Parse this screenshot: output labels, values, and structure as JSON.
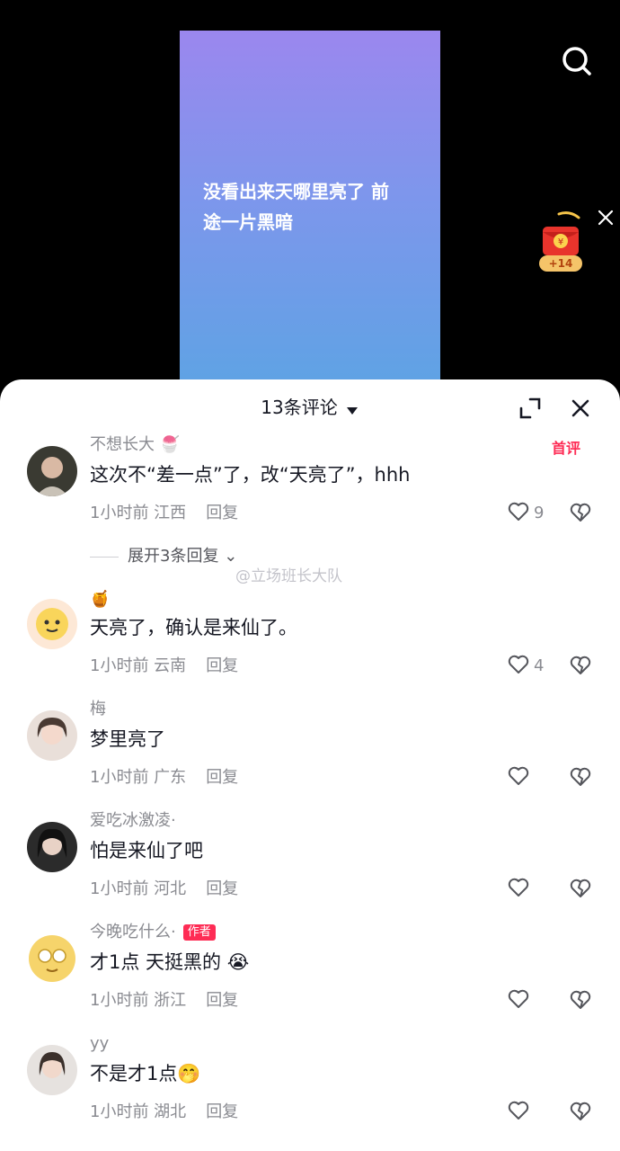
{
  "video": {
    "caption": "没看出来天哪里亮了 前途一片黑暗",
    "redpacket_count": "+14"
  },
  "comments_panel": {
    "title": "13条评论",
    "expand_replies": "展开3条回复",
    "watermark": "@立场班长大队",
    "first_badge": "首评",
    "author_tag": "作者",
    "reply_label": "回复",
    "comments": [
      {
        "user": "不想长大",
        "text": "这次不“差一点”了，改“天亮了”，hhh",
        "time": "1小时前 江西",
        "likes": "9"
      },
      {
        "user": "",
        "text": "天亮了，确认是来仙了。",
        "time": "1小时前 云南",
        "likes": "4"
      },
      {
        "user": "梅",
        "text": "梦里亮了",
        "time": "1小时前 广东",
        "likes": ""
      },
      {
        "user": "爱吃冰激凌·",
        "text": "怕是来仙了吧",
        "time": "1小时前 河北",
        "likes": ""
      },
      {
        "user": "今晚吃什么·",
        "text": "才1点 天挺黑的",
        "time": "1小时前 浙江",
        "likes": ""
      },
      {
        "user": "yy",
        "text": "不是才1点",
        "time": "1小时前 湖北",
        "likes": ""
      }
    ]
  },
  "colors": {
    "accent": "#fe2c55",
    "muted": "#8a8b91",
    "text": "#161823"
  }
}
